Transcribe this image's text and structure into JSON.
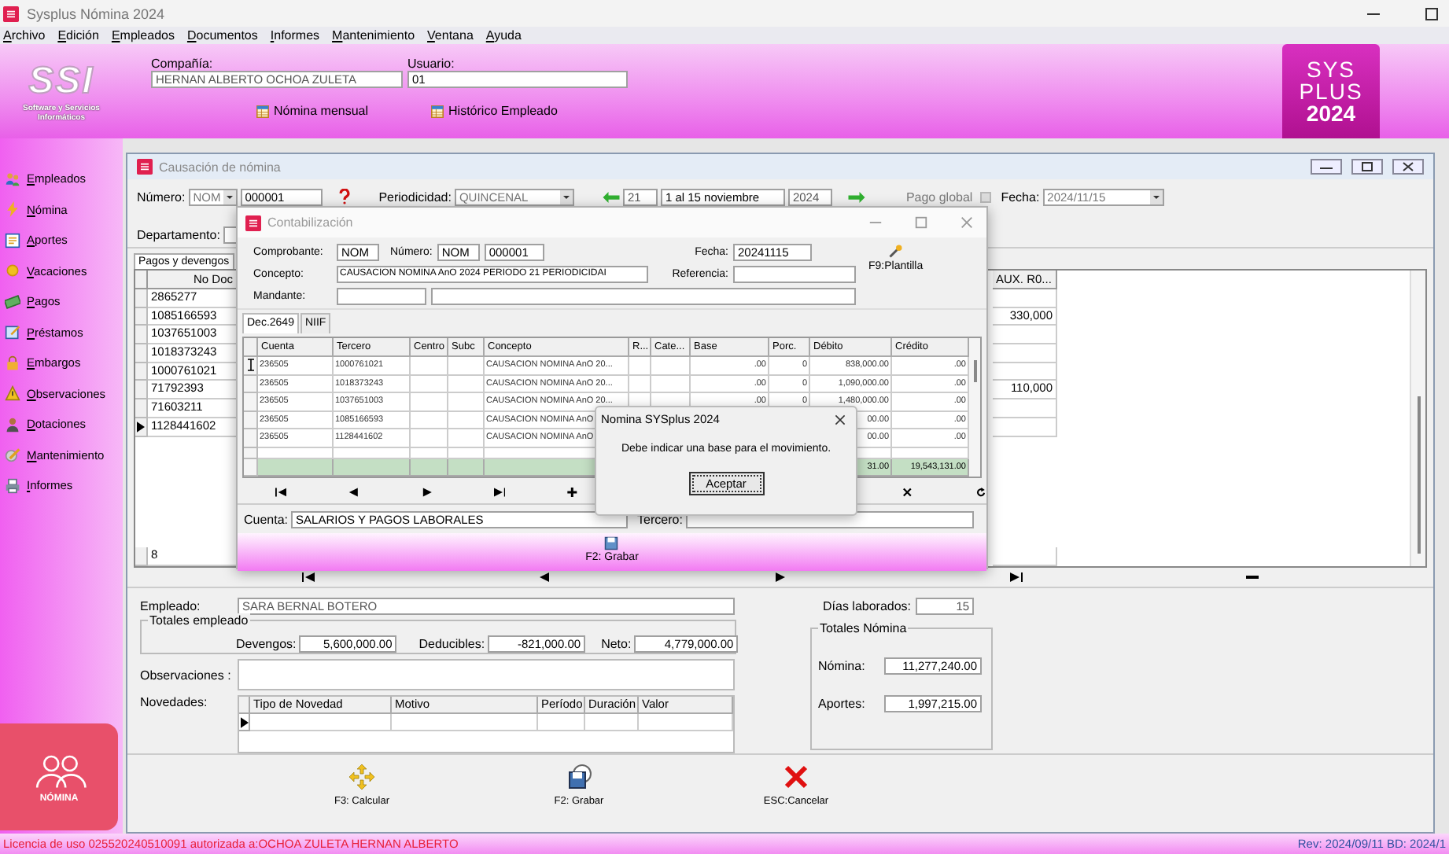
{
  "app": {
    "title": "Sysplus Nómina 2024"
  },
  "menu": [
    {
      "label": "Archivo"
    },
    {
      "label": "Edición"
    },
    {
      "label": "Empleados"
    },
    {
      "label": "Documentos"
    },
    {
      "label": "Informes"
    },
    {
      "label": "Mantenimiento"
    },
    {
      "label": "Ventana"
    },
    {
      "label": "Ayuda"
    }
  ],
  "header": {
    "logo_text": "SSI",
    "logo_caption": "Software y Servicios Informáticos",
    "company_label": "Compañía:",
    "company": "HERNAN ALBERTO OCHOA ZULETA",
    "user_label": "Usuario:",
    "user": "01",
    "links": [
      {
        "label": "Nómina mensual"
      },
      {
        "label": "Histórico Empleado"
      }
    ],
    "brand": [
      "SYS",
      "PLUS",
      "2024"
    ]
  },
  "sidebar": {
    "items": [
      {
        "label": "Empleados"
      },
      {
        "label": "Nómina"
      },
      {
        "label": "Aportes"
      },
      {
        "label": "Vacaciones"
      },
      {
        "label": "Pagos"
      },
      {
        "label": "Préstamos"
      },
      {
        "label": "Embargos"
      },
      {
        "label": "Observaciones"
      },
      {
        "label": "Dotaciones"
      },
      {
        "label": "Mantenimiento"
      },
      {
        "label": "Informes"
      }
    ],
    "badge": "NÓMINA"
  },
  "causacion": {
    "title": "Causación de nómina",
    "numero_label": "Número:",
    "numero_type": "NOM",
    "numero": "000001",
    "periodicidad_label": "Periodicidad:",
    "periodicidad": "QUINCENAL",
    "period": "21",
    "period_desc": "1 al 15 noviembre",
    "year": "2024",
    "pago_global": {
      "label": "Pago global",
      "checked": false,
      "disabled": true
    },
    "fecha_label": "Fecha:",
    "fecha": "2024/11/15",
    "departamento_label": "Departamento:",
    "tabs": [
      {
        "label": "Pagos y devengos",
        "selected": true
      }
    ],
    "grid": {
      "columns": [
        "No Doc",
        "AUX. R0..."
      ],
      "rows": [
        {
          "no_doc": "2865277",
          "selected": false
        },
        {
          "no_doc": "1085166593",
          "aux": "330,000",
          "selected": false
        },
        {
          "no_doc": "1037651003",
          "selected": false
        },
        {
          "no_doc": "1018373243",
          "selected": false
        },
        {
          "no_doc": "1000761021",
          "selected": false
        },
        {
          "no_doc": "71792393",
          "aux": "110,000",
          "selected": false
        },
        {
          "no_doc": "71603211",
          "selected": false
        },
        {
          "no_doc": "1128441602",
          "selected": true
        }
      ],
      "count": "8"
    },
    "empleado_label": "Empleado:",
    "empleado": "SARA BERNAL BOTERO",
    "dias_label": "Días laborados:",
    "dias": "15",
    "totales_empleado": {
      "title": "Totales empleado",
      "devengos_label": "Devengos:",
      "devengos": "5,600,000.00",
      "deducibles_label": "Deducibles:",
      "deducibles": "-821,000.00",
      "neto_label": "Neto:",
      "neto": "4,779,000.00"
    },
    "observaciones_label": "Observaciones :",
    "novedades_label": "Novedades:",
    "novedades_columns": [
      "Tipo de Novedad",
      "Motivo",
      "Período",
      "Duración",
      "Valor"
    ],
    "totales_nomina": {
      "title": "Totales Nómina",
      "nomina_label": "Nómina:",
      "nomina": "11,277,240.00",
      "aportes_label": "Aportes:",
      "aportes": "1,997,215.00"
    },
    "actions": [
      {
        "label": "F3: Calcular",
        "kind": "calculate"
      },
      {
        "label": "F2: Grabar",
        "kind": "save"
      },
      {
        "label": "ESC:Cancelar",
        "kind": "cancel"
      }
    ]
  },
  "contabilizacion": {
    "title": "Contabilización",
    "comprobante_label": "Comprobante:",
    "comprobante": "NOM",
    "numero_label": "Número:",
    "numero_type": "NOM",
    "numero": "000001",
    "fecha_label": "Fecha:",
    "fecha": "20241115",
    "concepto_label": "Concepto:",
    "concepto": "CAUSACION NOMINA AnO 2024 PERIODO 21 PERIODICIDAI",
    "referencia_label": "Referencia:",
    "mandante_label": "Mandante:",
    "plantilla": "F9:Plantilla",
    "tabs": [
      {
        "label": "Dec.2649",
        "selected": true
      },
      {
        "label": "NIIF",
        "selected": false
      }
    ],
    "grid": {
      "columns": [
        "Cuenta",
        "Tercero",
        "Centro",
        "Subc",
        "Concepto",
        "R...",
        "Cate...",
        "Base",
        "Porc.",
        "Débito",
        "Crédito"
      ],
      "rows": [
        {
          "selected": true,
          "cells": [
            "236505",
            "1000761021",
            null,
            null,
            "CAUSACION NOMINA AnO 20...",
            null,
            null,
            ".00",
            "0",
            "838,000.00",
            ".00"
          ]
        },
        {
          "selected": false,
          "cells": [
            "236505",
            "1018373243",
            null,
            null,
            "CAUSACION NOMINA AnO 20...",
            null,
            null,
            ".00",
            "0",
            "1,090,000.00",
            ".00"
          ]
        },
        {
          "selected": false,
          "cells": [
            "236505",
            "1037651003",
            null,
            null,
            "CAUSACION NOMINA AnO 20...",
            null,
            null,
            ".00",
            "0",
            "1,480,000.00",
            ".00"
          ]
        },
        {
          "selected": false,
          "cells": [
            "236505",
            "1085166593",
            null,
            null,
            "CAUSACION NOMINA AnO",
            null,
            null,
            null,
            null,
            "00.00",
            ".00"
          ]
        },
        {
          "selected": false,
          "cells": [
            "236505",
            "1128441602",
            null,
            null,
            "CAUSACION NOMINA AnO",
            null,
            null,
            null,
            null,
            "00.00",
            ".00"
          ]
        }
      ],
      "totals": {
        "debito": "31.00",
        "credito": "19,543,131.00"
      }
    },
    "cuenta_label": "Cuenta:",
    "cuenta": "SALARIOS Y PAGOS LABORALES",
    "tercero_label": "Tercero:",
    "save": "F2: Grabar"
  },
  "message_box": {
    "title": "Nomina SYSplus 2024",
    "text": "Debe indicar una base para el movimiento.",
    "button": "Aceptar"
  },
  "status_bar": {
    "license": "Licencia de uso 025520240510091 autorizada a:OCHOA ZULETA HERNAN ALBERTO",
    "revision": "Rev: 2024/09/11 BD: 2024/1"
  }
}
